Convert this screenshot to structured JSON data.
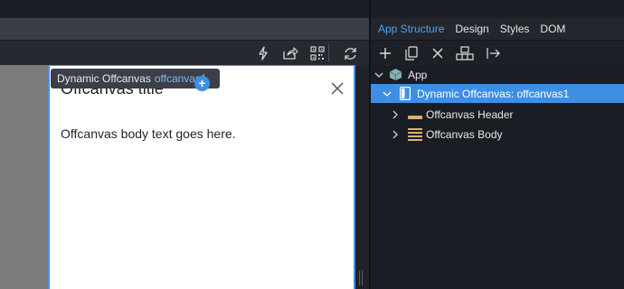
{
  "canvas": {
    "tooltip": {
      "type_label": "Dynamic Offcanvas",
      "id_label": "offcanvas1"
    },
    "offcanvas": {
      "title": "Offcanvas title",
      "body_text": "Offcanvas body text goes here."
    }
  },
  "left_toolbar": {
    "icons": [
      "lightning-icon",
      "share-icon",
      "qr-code-icon",
      "refresh-icon"
    ]
  },
  "panel": {
    "tabs": [
      {
        "label": "App Structure",
        "active": true
      },
      {
        "label": "Design",
        "active": false
      },
      {
        "label": "Styles",
        "active": false
      },
      {
        "label": "DOM",
        "active": false
      }
    ],
    "toolbar_icons": [
      "add-icon",
      "duplicate-icon",
      "delete-icon",
      "component-icon",
      "move-icon"
    ],
    "tree": {
      "root": {
        "label": "App",
        "icon": "cube-icon"
      },
      "selected": {
        "label": "Dynamic Offcanvas: offcanvas1",
        "icon": "offcanvas-icon"
      },
      "children": [
        {
          "label": "Offcanvas Header",
          "icon": "header-icon"
        },
        {
          "label": "Offcanvas Body",
          "icon": "body-icon"
        }
      ]
    }
  },
  "colors": {
    "accent": "#3d8fe6",
    "active_tab": "#4ba3f5",
    "panel_bg": "#1b1d24",
    "tree_icon_tan": "#d9b07a"
  }
}
